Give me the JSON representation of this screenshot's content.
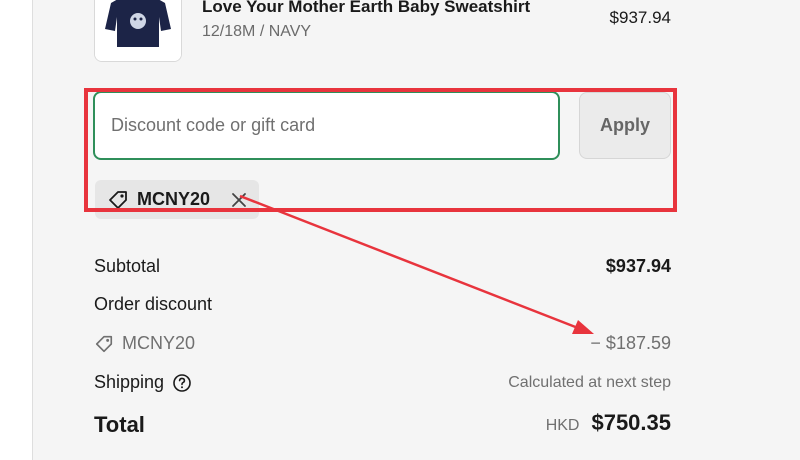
{
  "product": {
    "name": "Love Your Mother Earth Baby Sweatshirt",
    "variant": "12/18M / NAVY",
    "price": "$937.94"
  },
  "discount": {
    "placeholder": "Discount code or gift card",
    "value": "",
    "apply_label": "Apply",
    "applied_code": "MCNY20"
  },
  "summary": {
    "subtotal_label": "Subtotal",
    "subtotal_value": "$937.94",
    "order_discount_label": "Order discount",
    "discount_code": "MCNY20",
    "discount_amount": "− $187.59",
    "shipping_label": "Shipping",
    "shipping_value": "Calculated at next step",
    "total_label": "Total",
    "currency": "HKD",
    "total_value": "$750.35"
  },
  "colors": {
    "panel_bg": "#f5f5f5",
    "input_focus_border": "#2f8f5a",
    "annotation_red": "#e8343d",
    "muted_text": "#707070"
  },
  "icons": {
    "tag": "tag-icon",
    "remove": "close-icon",
    "help": "question-circle-icon"
  }
}
